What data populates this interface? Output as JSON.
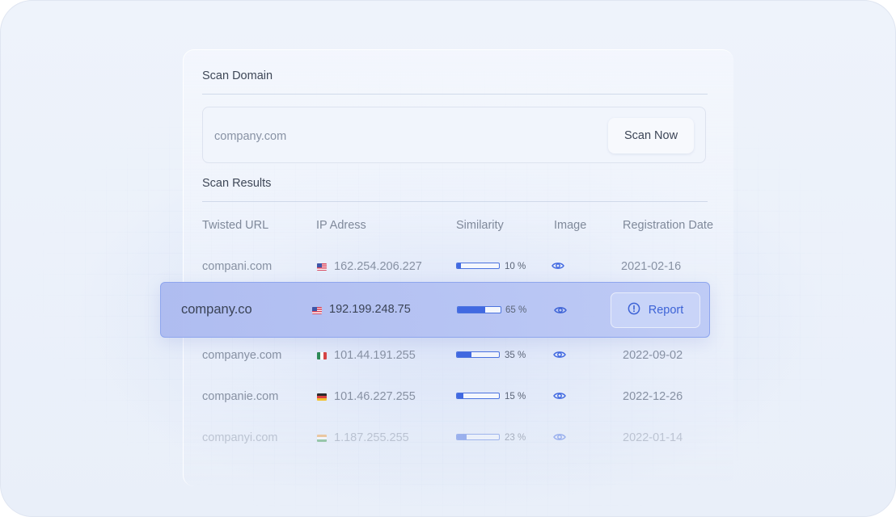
{
  "scan_domain": {
    "title": "Scan Domain",
    "input_value": "company.com",
    "button_label": "Scan Now"
  },
  "scan_results": {
    "title": "Scan Results",
    "columns": [
      "Twisted URL",
      "IP Adress",
      "Similarity",
      "Image",
      "Registration Date"
    ],
    "rows": [
      {
        "url": "compani.com",
        "flag": "us-flag-icon",
        "ip": "162.254.206.227",
        "similarity": 10,
        "similarity_label": "10 %",
        "image_icon": "eye-icon",
        "date": "2021-02-16"
      },
      {
        "url": "company.co",
        "flag": "us-flag-icon",
        "ip": "192.199.248.75",
        "similarity": 65,
        "similarity_label": "65 %",
        "image_icon": "eye-icon",
        "action": "Report",
        "action_icon": "alert-circle-icon"
      },
      {
        "url": "companye.com",
        "flag": "mx-flag-icon",
        "ip": "101.44.191.255",
        "similarity": 35,
        "similarity_label": "35 %",
        "image_icon": "eye-icon",
        "date": "2022-09-02"
      },
      {
        "url": "companie.com",
        "flag": "de-flag-icon",
        "ip": "101.46.227.255",
        "similarity": 15,
        "similarity_label": "15 %",
        "image_icon": "eye-icon",
        "date": "2022-12-26"
      },
      {
        "url": "companyi.com",
        "flag": "in-flag-icon",
        "ip": "1.187.255.255",
        "similarity": 23,
        "similarity_label": "23 %",
        "image_icon": "eye-icon",
        "date": "2022-01-14"
      }
    ]
  },
  "colors": {
    "accent": "#4169e1",
    "highlight_bg": "#b4c2f2",
    "text_muted": "#8791a3"
  }
}
